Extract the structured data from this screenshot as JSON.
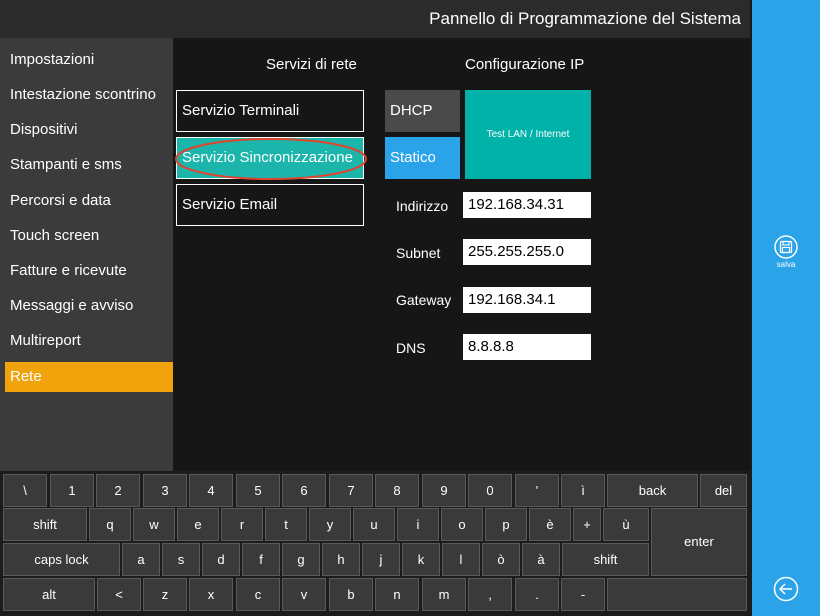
{
  "header": {
    "title": "Pannello di Programmazione del Sistema"
  },
  "rightbar": {
    "save_label": "salva",
    "save_icon": "floppy-disk-icon",
    "back_icon": "back-arrow-icon"
  },
  "sidebar": {
    "items": [
      {
        "label": "Impostazioni"
      },
      {
        "label": "Intestazione scontrino"
      },
      {
        "label": "Dispositivi"
      },
      {
        "label": "Stampanti e sms"
      },
      {
        "label": "Percorsi e data"
      },
      {
        "label": "Touch screen"
      },
      {
        "label": "Fatture e ricevute"
      },
      {
        "label": "Messaggi e avviso"
      },
      {
        "label": "Multireport"
      },
      {
        "label": "Rete"
      }
    ],
    "active_index": 9
  },
  "services": {
    "title": "Servizi di rete",
    "items": [
      {
        "label": "Servizio Terminali"
      },
      {
        "label": "Servizio Sincronizzazione"
      },
      {
        "label": "Servizio Email"
      }
    ],
    "active_index": 1
  },
  "ipconfig": {
    "title": "Configurazione IP",
    "dhcp_label": "DHCP",
    "static_label": "Statico",
    "test_label": "Test LAN / Internet",
    "fields": [
      {
        "label": "Indirizzo",
        "value": "192.168.34.31"
      },
      {
        "label": "Subnet",
        "value": "255.255.255.0"
      },
      {
        "label": "Gateway",
        "value": "192.168.34.1"
      },
      {
        "label": "DNS",
        "value": "8.8.8.8"
      }
    ]
  },
  "keyboard": {
    "rows": [
      [
        "\\",
        "1",
        "2",
        "3",
        "4",
        "5",
        "6",
        "7",
        "8",
        "9",
        "0",
        "'",
        "ì",
        "back",
        "del"
      ],
      [
        "shift",
        "q",
        "w",
        "e",
        "r",
        "t",
        "y",
        "u",
        "i",
        "o",
        "p",
        "è",
        "+",
        "ù",
        "enter"
      ],
      [
        "caps lock",
        "a",
        "s",
        "d",
        "f",
        "g",
        "h",
        "j",
        "k",
        "l",
        "ò",
        "à",
        "shift"
      ],
      [
        "alt",
        "<",
        "z",
        "x",
        "c",
        "v",
        "b",
        "n",
        "m",
        ",",
        ".",
        "-",
        ""
      ]
    ]
  },
  "colors": {
    "accent_blue": "#2aa3e8",
    "active_orange": "#f0a30a",
    "teal": "#1bb5ac",
    "highlight_red": "#e0452d"
  }
}
